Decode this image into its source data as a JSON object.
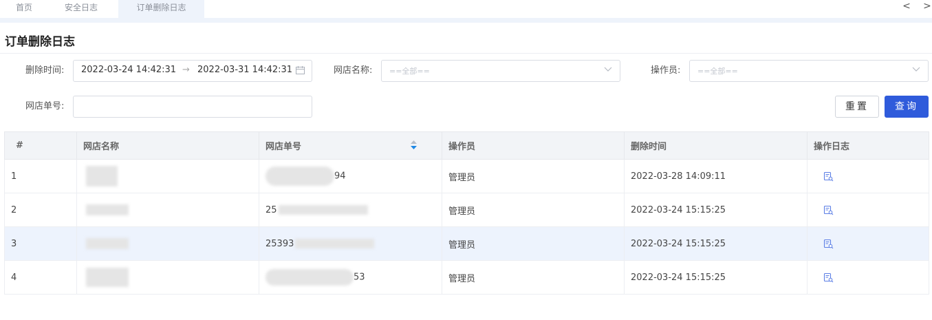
{
  "tabs": [
    {
      "label": "首页",
      "active": false
    },
    {
      "label": "安全日志",
      "active": false
    },
    {
      "label": "订单删除日志",
      "active": true
    }
  ],
  "nav": {
    "prev": "<",
    "next": ">"
  },
  "page_title": "订单删除日志",
  "filters": {
    "delete_time_label": "删除时间:",
    "delete_time_start": "2022-03-24 14:42:31",
    "delete_time_end": "2022-03-31 14:42:31",
    "range_separator": "→",
    "shop_name_label": "网店名称:",
    "shop_name_placeholder": "==全部==",
    "operator_label": "操作员:",
    "operator_placeholder": "==全部==",
    "order_no_label": "网店单号:",
    "order_no_value": ""
  },
  "buttons": {
    "reset": "重置",
    "query": "查询"
  },
  "table": {
    "columns": [
      "#",
      "网店名称",
      "网店单号",
      "操作员",
      "删除时间",
      "操作日志"
    ],
    "rows": [
      {
        "index": "1",
        "order_no_visible": "94",
        "operator": "管理员",
        "deleted_at": "2022-03-28 14:09:11"
      },
      {
        "index": "2",
        "order_no_visible": "25",
        "operator": "管理员",
        "deleted_at": "2022-03-24 15:15:25"
      },
      {
        "index": "3",
        "order_no_visible": "25393",
        "operator": "管理员",
        "deleted_at": "2022-03-24 15:15:25"
      },
      {
        "index": "4",
        "order_no_visible": "53",
        "operator": "管理员",
        "deleted_at": "2022-03-24 15:15:25"
      }
    ],
    "highlighted_row": 3
  },
  "icons": {
    "sort": "sort-icon",
    "calendar": "calendar-icon",
    "dropdown": "chevron-down-icon",
    "log": "document-search-icon"
  },
  "colors": {
    "primary": "#2f5bdb",
    "tab_active_bg": "#eef3fb",
    "row_highlight": "#edf3fd",
    "sort_active": "#1e88e5"
  }
}
